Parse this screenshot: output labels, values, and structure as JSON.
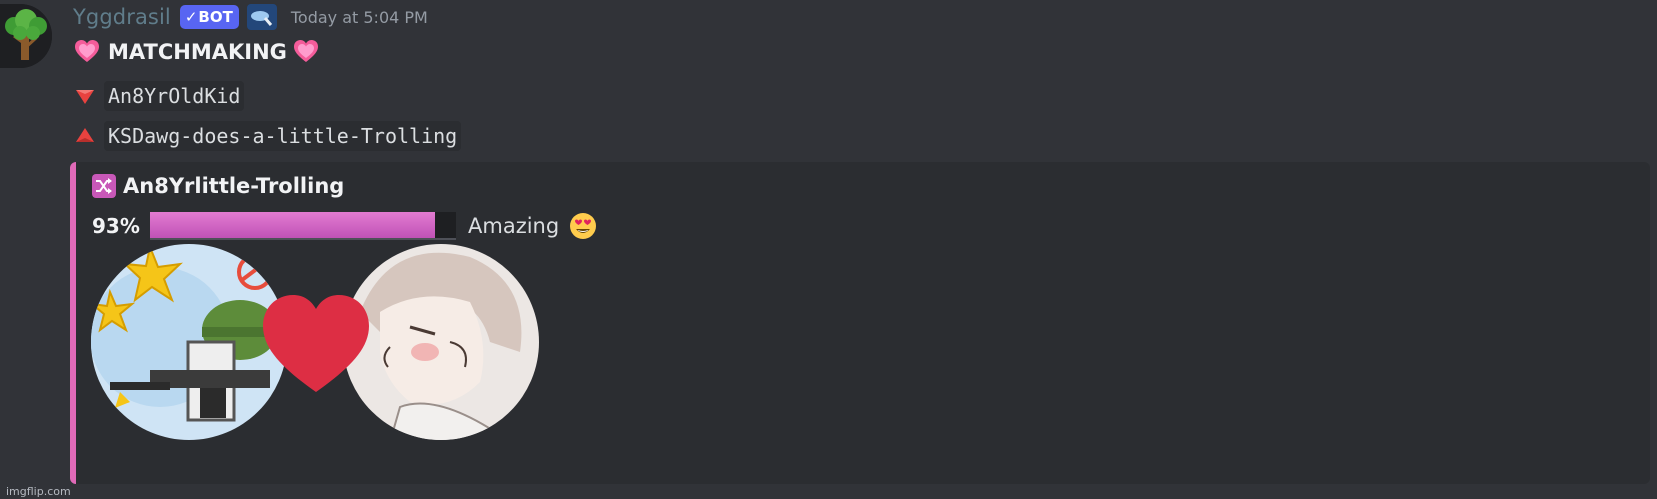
{
  "message": {
    "author": {
      "avatar_icon": "tree-icon",
      "username": "Yggdrasil",
      "username_color": "#607d8b",
      "bot_tag": "BOT",
      "bot_tag_icon": "checkmark-icon",
      "app_badge_icon": "app-badge-icon",
      "timestamp": "Today at 5:04 PM"
    },
    "content": {
      "title_emoji": "sparkling-heart-icon",
      "title": "MATCHMAKING",
      "lines": [
        {
          "icon": "red-triangle-down-icon",
          "text": "An8YrOldKid"
        },
        {
          "icon": "red-triangle-up-icon",
          "text": "KSDawg-does-a-little-Trolling"
        }
      ]
    },
    "embed": {
      "accent_color": "#e06ab8",
      "title_icon": "shuffle-icon",
      "title": "An8Yrlittle-Trolling",
      "percent_label": "93%",
      "progress": 0.93,
      "rating": "Amazing",
      "rating_emoji": "heart-eyes-icon",
      "image": {
        "left_avatar": "soldier-cartoon-avatar",
        "center_icon": "red-heart-icon",
        "right_avatar": "anime-boy-avatar"
      }
    }
  },
  "watermark": "imgflip.com"
}
